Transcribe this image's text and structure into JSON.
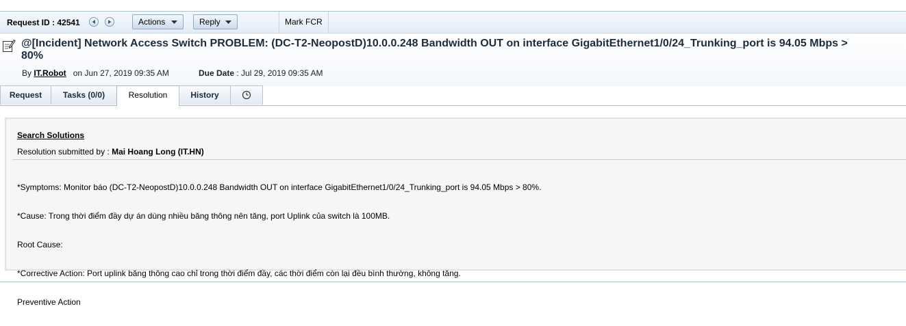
{
  "toolbar": {
    "request_id": "Request ID : 42541",
    "actions_label": "Actions",
    "reply_label": "Reply",
    "mark_fcr_label": "Mark FCR"
  },
  "header": {
    "title": "@[Incident] Network Access Switch PROBLEM: (DC-T2-NeopostD)10.0.0.248 Bandwidth OUT on interface GigabitEthernet1/0/24_Trunking_port is 94.05 Mbps > 80%",
    "by_prefix": "By",
    "author": "IT.Robot",
    "on_prefix": "on",
    "created": "Jun 27, 2019 09:35 AM",
    "due_label": "Due Date",
    "due_value": ": Jul 29, 2019 09:35 AM"
  },
  "tabs": [
    {
      "label": "Request"
    },
    {
      "label": "Tasks (0/0)"
    },
    {
      "label": "Resolution"
    },
    {
      "label": "History"
    }
  ],
  "resolution": {
    "search_solutions": "Search Solutions",
    "submitted_prefix": "Resolution submitted by : ",
    "submitted_by": "Mai Hoang Long (IT.HN)",
    "lines": [
      "*Symptoms: Monitor báo (DC-T2-NeopostD)10.0.0.248 Bandwidth OUT on interface GigabitEthernet1/0/24_Trunking_port is 94.05 Mbps > 80%.",
      "*Cause: Trong thời điểm đầy dự án dùng nhiều băng thông nên tăng, port Uplink của switch là 100MB.",
      "Root Cause:",
      "*Corrective Action: Port uplink băng thông cao chỉ trong thời điểm đầy, các thời điểm còn lại đều bình thường, không tăng.",
      "Preventive Action"
    ]
  },
  "icons": {
    "prev": "circle-left-arrow-icon",
    "next": "circle-right-arrow-icon",
    "dropdown": "caret-down-icon",
    "document": "edit-document-icon",
    "history_clock": "clock-icon"
  },
  "colors": {
    "toolbar_bg": "#e3edf7",
    "border_accent": "#9fc6d6",
    "panel_bg": "#f6f6f6"
  }
}
